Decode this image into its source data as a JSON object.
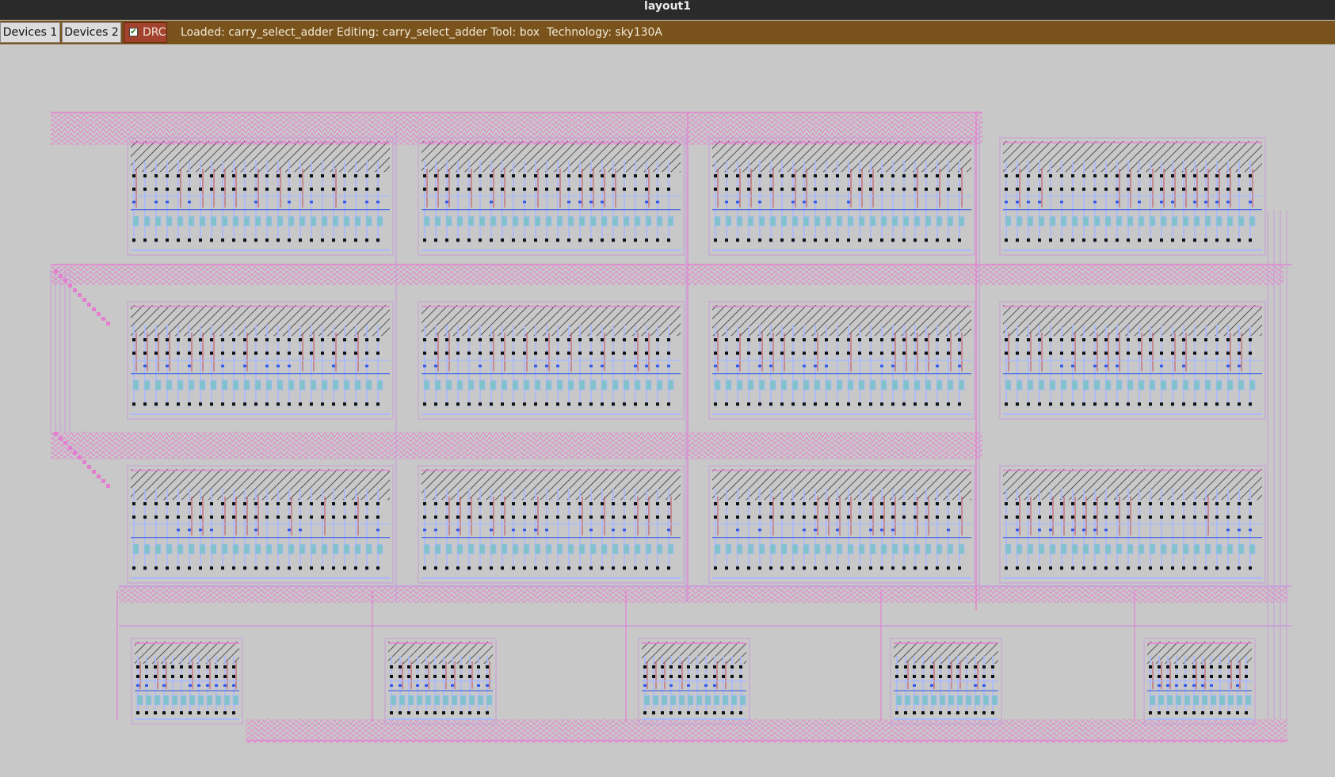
{
  "window": {
    "title": "layout1"
  },
  "toolbar": {
    "devices1_label": "Devices 1",
    "devices2_label": "Devices 2",
    "drc_label": "DRC",
    "drc_checked": true,
    "status": "Loaded: carry_select_adder Editing: carry_select_adder Tool: box  Technology: sky130A"
  },
  "colors": {
    "canvas_bg": "#c8c8c8",
    "metal1": "#a9b8ff",
    "metal2": "#c9a3d6",
    "poly": "#e47fd0",
    "diffusion": "#2f56e8",
    "contact": "#111111",
    "hatch": "#222222",
    "toolbar_bg": "#7a521c"
  },
  "layout": {
    "cell": "carry_select_adder",
    "technology": "sky130A",
    "large_cell_rows": 3,
    "large_cells_per_row": 4,
    "small_cells": 5
  }
}
